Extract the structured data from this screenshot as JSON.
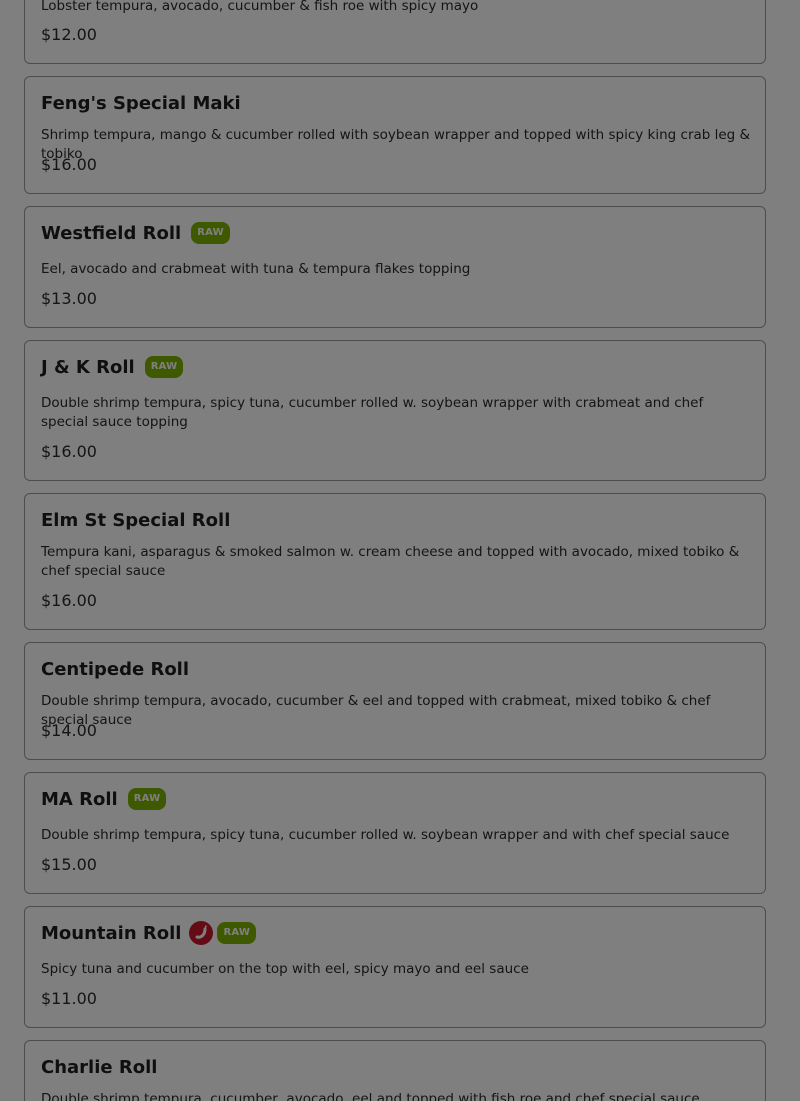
{
  "colors": {
    "raw_badge": "#7fb200",
    "spicy_icon": "#c8162d",
    "overlay": "rgba(0,0,0,0.5)"
  },
  "menu": {
    "raw_label": "RAW",
    "items": [
      {
        "name": "",
        "description": "Lobster tempura, avocado, cucumber & fish roe with spicy mayo",
        "price": "$12.00"
      },
      {
        "name": "Feng's Special Maki",
        "description": "Shrimp tempura, mango & cucumber rolled with soybean wrapper and topped with spicy king crab leg & tobiko",
        "price": "$16.00"
      },
      {
        "name": "Westfield Roll",
        "raw": true,
        "description": "Eel, avocado and crabmeat with tuna & tempura flakes topping",
        "price": "$13.00"
      },
      {
        "name": "J & K Roll",
        "raw": true,
        "description": "Double shrimp tempura, spicy tuna, cucumber rolled w. soybean wrapper with crabmeat and chef special sauce topping",
        "price": "$16.00"
      },
      {
        "name": "Elm St Special Roll",
        "description": "Tempura kani, asparagus & smoked salmon w. cream cheese and topped with avocado, mixed tobiko & chef special sauce",
        "price": "$16.00"
      },
      {
        "name": "Centipede Roll",
        "description": "Double shrimp tempura, avocado, cucumber & eel and topped with crabmeat, mixed tobiko & chef special sauce",
        "price": "$14.00"
      },
      {
        "name": "MA Roll",
        "raw": true,
        "description": "Double shrimp tempura, spicy tuna, cucumber rolled w. soybean wrapper and with chef special sauce",
        "price": "$15.00"
      },
      {
        "name": "Mountain Roll",
        "spicy": true,
        "spicy_icon": "chili-pepper-icon",
        "raw": true,
        "description": "Spicy tuna and cucumber on the top with eel, spicy mayo and eel sauce",
        "price": "$11.00"
      },
      {
        "name": "Charlie Roll",
        "description": "Double shrimp tempura, cucumber, avocado, eel and topped with fish roe and chef special sauce",
        "price": ""
      }
    ]
  }
}
